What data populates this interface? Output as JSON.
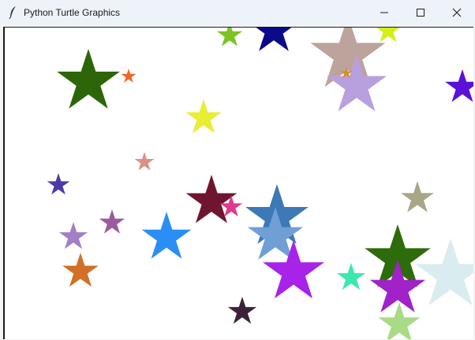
{
  "window": {
    "title": "Python Turtle Graphics",
    "icons": {
      "app": "feather-icon",
      "minimize": "minimize-icon",
      "maximize": "maximize-icon",
      "close": "close-icon"
    }
  },
  "canvas": {
    "background": "#ffffff",
    "shapes": [
      {
        "name": "star",
        "color": "#7bc424"
      },
      {
        "name": "star",
        "color": "#0a0a8a"
      },
      {
        "name": "star",
        "color": "#bda39b"
      },
      {
        "name": "star",
        "color": "#d4ee18"
      },
      {
        "name": "star",
        "color": "#2d6609"
      },
      {
        "name": "star",
        "color": "#ee6a2b"
      },
      {
        "name": "star",
        "color": "#b8a0de"
      },
      {
        "name": "star",
        "color": "#d0902e"
      },
      {
        "name": "star",
        "color": "#5a10d8"
      },
      {
        "name": "star",
        "color": "#e8ed36"
      },
      {
        "name": "star",
        "color": "#d79383"
      },
      {
        "name": "star",
        "color": "#4c39a8"
      },
      {
        "name": "star",
        "color": "#6f1530"
      },
      {
        "name": "star",
        "color": "#e2388e"
      },
      {
        "name": "star",
        "color": "#3c79b6"
      },
      {
        "name": "star",
        "color": "#6f9fd4"
      },
      {
        "name": "star",
        "color": "#a8a685"
      },
      {
        "name": "star",
        "color": "#9b5c9b"
      },
      {
        "name": "star",
        "color": "#a27fc9"
      },
      {
        "name": "star",
        "color": "#2a8ef5"
      },
      {
        "name": "star",
        "color": "#d17026"
      },
      {
        "name": "star",
        "color": "#a823e8"
      },
      {
        "name": "star",
        "color": "#3be8b0"
      },
      {
        "name": "star",
        "color": "#2d6c0a"
      },
      {
        "name": "star",
        "color": "#d9ecef"
      },
      {
        "name": "star",
        "color": "#a022c8"
      },
      {
        "name": "star",
        "color": "#3c2238"
      },
      {
        "name": "star",
        "color": "#a7db86"
      }
    ]
  }
}
